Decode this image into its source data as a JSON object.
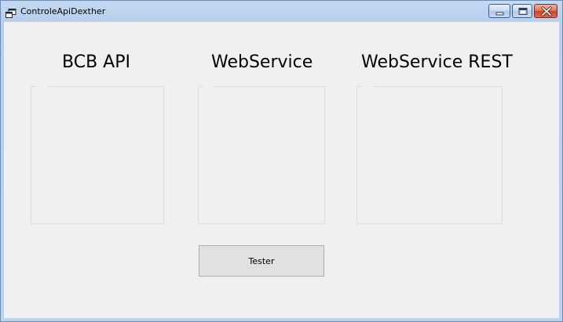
{
  "window": {
    "title": "ControleApiDexther"
  },
  "headings": {
    "bcb_api": "BCB API",
    "webservice": "WebService",
    "webservice_rest": "WebService REST"
  },
  "buttons": {
    "tester": "Tester"
  },
  "icons": {
    "app": "app-window-icon",
    "minimize": "minimize-icon",
    "maximize": "maximize-icon",
    "close": "close-icon"
  },
  "colors": {
    "client_background": "#f0f0f0",
    "close_button": "#c8442a",
    "panel_border": "#dcdcdc"
  }
}
